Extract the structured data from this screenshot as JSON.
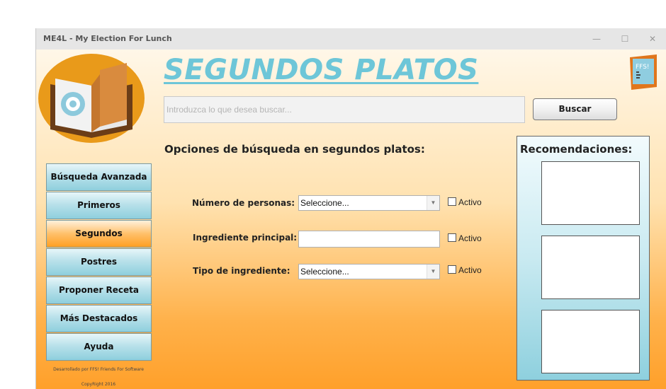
{
  "window": {
    "title": "ME4L - My Election For Lunch",
    "minimize": "—",
    "maximize": "☐",
    "close": "✕"
  },
  "header": {
    "title": "SEGUNDOS PLATOS",
    "ffs_logo_text": "FFS!"
  },
  "search": {
    "placeholder": "Introduzca lo que desea buscar...",
    "value": "",
    "button_label": "Buscar"
  },
  "section_title": "Opciones de búsqueda en segundos platos:",
  "sidebar": {
    "items": [
      {
        "label": "Búsqueda Avanzada",
        "active": false
      },
      {
        "label": "Primeros",
        "active": false
      },
      {
        "label": "Segundos",
        "active": true
      },
      {
        "label": "Postres",
        "active": false
      },
      {
        "label": "Proponer Receta",
        "active": false
      },
      {
        "label": "Más Destacados",
        "active": false
      },
      {
        "label": "Ayuda",
        "active": false
      }
    ],
    "developed_by": "Desarrollado por FFS! Friends For Software",
    "copyright": "CopyRight 2016"
  },
  "form": {
    "personas_label": "Número de personas:",
    "personas_value": "Seleccione...",
    "ingrediente_label": "Ingrediente principal:",
    "ingrediente_value": "",
    "tipo_label": "Tipo de ingrediente:",
    "tipo_value": "Seleccione...",
    "activo_label": "Activo"
  },
  "recommendations": {
    "title": "Recomendaciones:"
  },
  "colors": {
    "accent_blue": "#6dc6d8",
    "nav_active": "#ffa02a",
    "background_bottom": "#ffa02a"
  }
}
